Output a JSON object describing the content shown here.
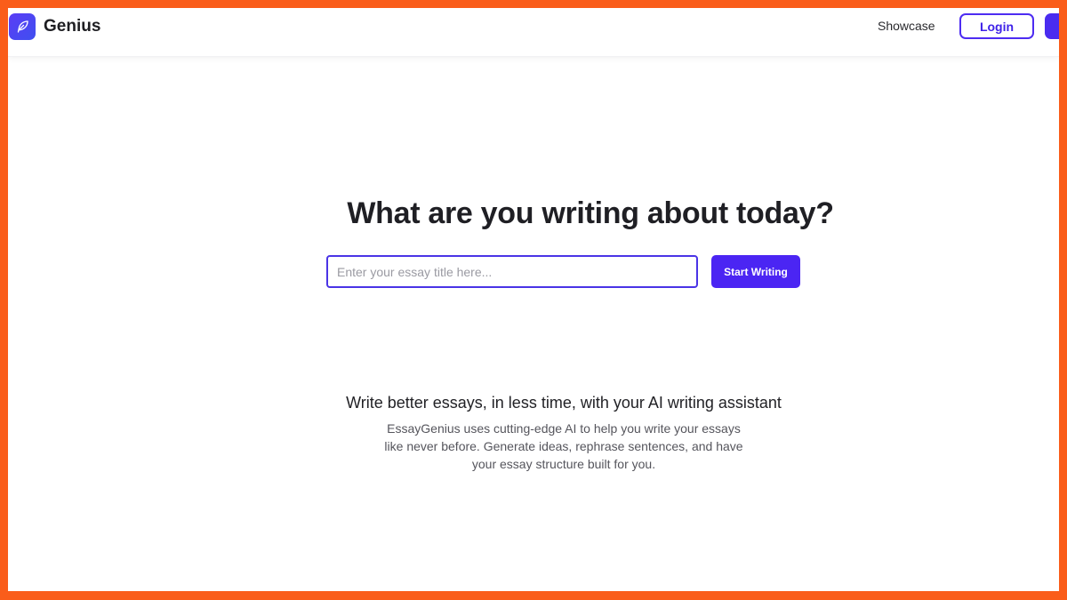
{
  "header": {
    "brand": "Genius",
    "nav_showcase": "Showcase",
    "login_label": "Login",
    "brand_color": "#4B25F3"
  },
  "hero": {
    "headline": "What are you writing about today?",
    "input_placeholder": "Enter your essay title here...",
    "input_value": "",
    "start_label": "Start Writing"
  },
  "info": {
    "subheading": "Write better essays, in less time, with your AI writing assistant",
    "description": "EssayGenius uses cutting-edge AI to help you write your essays like never before. Generate ideas, rephrase sentences, and have your essay structure built for you."
  },
  "icons": {
    "logo": "feather-icon"
  }
}
